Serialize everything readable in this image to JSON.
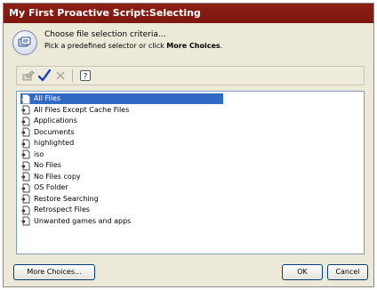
{
  "window": {
    "title": "My First Proactive Script:Selecting"
  },
  "header": {
    "line1": "Choose file selection criteria...",
    "line2_prefix": "Pick a predefined selector or click ",
    "line2_bold": "More Choices",
    "line2_suffix": "."
  },
  "toolbar": {
    "icons": [
      "edit-icon",
      "checkmark-icon",
      "delete-x-icon",
      "help-icon"
    ]
  },
  "list": {
    "items": [
      {
        "label": "All Files",
        "selected": true
      },
      {
        "label": "All Files Except Cache Files"
      },
      {
        "label": "Applications"
      },
      {
        "label": "Documents"
      },
      {
        "label": "highlighted"
      },
      {
        "label": "iso"
      },
      {
        "label": "No Files"
      },
      {
        "label": "No Files copy"
      },
      {
        "label": "OS Folder"
      },
      {
        "label": "Restore Searching"
      },
      {
        "label": "Retrospect Files"
      },
      {
        "label": "Unwanted games and apps"
      }
    ]
  },
  "buttons": {
    "more_choices": "More Choices...",
    "ok": "OK",
    "cancel": "Cancel"
  },
  "colors": {
    "titlebar": "#8d1f16",
    "selection": "#316ac5",
    "checkmark": "#1f3fbf"
  }
}
